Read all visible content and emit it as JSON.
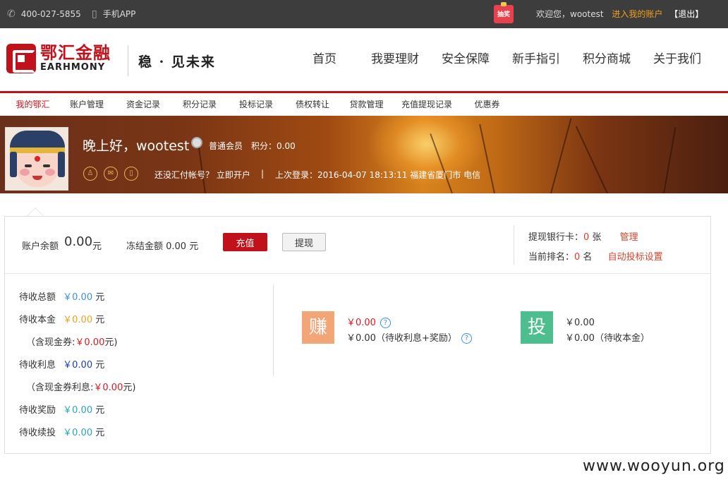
{
  "topbar": {
    "phone": "400-027-5855",
    "app": "手机APP",
    "lottery": "抽奖",
    "welcome": "欢迎您，wootest",
    "account_link": "进入我的账户",
    "logout": "【退出】"
  },
  "header": {
    "logo_cn": "鄂汇金融",
    "logo_en": "EARHMONY",
    "slogan": "稳 · 见未来",
    "nav": [
      "首页",
      "我要理财",
      "安全保障",
      "新手指引",
      "积分商城",
      "关于我们"
    ]
  },
  "subnav": [
    "我的鄂汇",
    "账户管理",
    "资金记录",
    "积分记录",
    "投标记录",
    "债权转让",
    "贷款管理",
    "充值提现记录",
    "优惠券"
  ],
  "banner": {
    "greeting": "晚上好，wootest",
    "level": "普通会员",
    "points": "积分：0.00",
    "open_account": "还没汇付帐号？ 立即开户",
    "separator": "|",
    "last_login": "上次登录：2016-04-07 18:13:11  福建省厦门市 电信"
  },
  "account": {
    "balance_label": "账户余额",
    "balance_value": "0.00",
    "balance_unit": "元",
    "frozen": "冻结金额 0.00 元",
    "charge_btn": "充值",
    "withdraw_btn": "提现",
    "card_label": "提现银行卡：",
    "card_count": "0",
    "card_unit": " 张",
    "card_manage": "管理",
    "rank_label": "当前排名：",
    "rank_value": "0",
    "rank_unit": " 名",
    "auto_bid": "自动投标设置"
  },
  "pending": [
    {
      "label": "待收总额",
      "value": "￥0.00",
      "unit": " 元"
    },
    {
      "label": "待收本金",
      "value": "￥0.00",
      "unit": " 元"
    },
    {
      "label": "（含现金券:",
      "value": "￥0.00",
      "unit": "元)"
    },
    {
      "label": "待收利息",
      "value": "￥0.00",
      "unit": " 元"
    },
    {
      "label": "（含现金券利息:",
      "value": "￥0.00",
      "unit": "元)"
    },
    {
      "label": "待收奖励",
      "value": "￥0.00",
      "unit": " 元"
    },
    {
      "label": "待收续投",
      "value": "￥0.00",
      "unit": " 元"
    }
  ],
  "earn": {
    "char": "赚",
    "value1": "￥0.00",
    "value2": "￥0.00（待收利息+奖励）"
  },
  "invest": {
    "char": "投",
    "value1": "￥0.00",
    "value2": "￥0.00（待收本金）"
  },
  "watermark": "www.wooyun.org"
}
